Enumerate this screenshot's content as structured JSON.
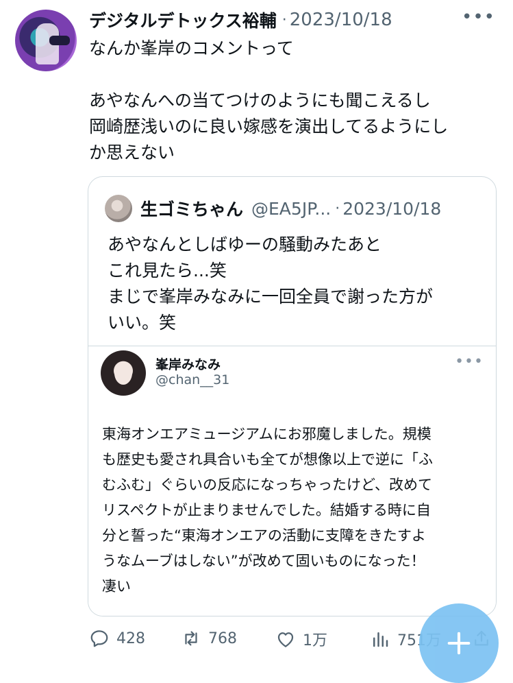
{
  "tweet": {
    "author_name": "デジタルデトックス裕輔",
    "separator": "·",
    "date": "2023/10/18",
    "more_label": "•••",
    "text": "なんか峯岸のコメントって\n\nあやなんへの当てつけのようにも聞こえるし\n岡崎歴浅いのに良い嫁感を演出してるようにし\nか思えない"
  },
  "quote": {
    "author_name": "生ゴミちゃん",
    "handle": "@EA5JP...",
    "separator": "·",
    "date": "2023/10/18",
    "text": "あやなんとしばゆーの騒動みたあと\nこれ見たら...笑\nまじで峯岸みなみに一回全員で謝った方が\nいい。笑",
    "embedded": {
      "author_name": "峯岸みなみ",
      "handle": "@chan__31",
      "more_label": "•••",
      "text": "東海オンエアミュージアムにお邪魔しました。規模\nも歴史も愛され具合いも全てが想像以上で逆に「ふ\nむふむ」ぐらいの反応になっちゃったけど、改めて\nリスペクトが止まりませんでした。結婚する時に自\n分と誓った“東海オンエアの活動に支障をきたすよ\nうなムーブはしない”が改めて固いものになった！\n凄い"
    }
  },
  "actions": {
    "replies": "428",
    "retweets": "768",
    "likes": "1万",
    "views": "751万"
  },
  "icons": {
    "reply": "reply-bubble-icon",
    "retweet": "retweet-icon",
    "like": "heart-icon",
    "views": "views-bar-chart-icon",
    "share": "share-icon",
    "compose": "compose-plus-icon"
  },
  "colors": {
    "text": "#0f1419",
    "secondary": "#536471",
    "border": "#cfd9de",
    "fab": "#7cc2f2"
  }
}
